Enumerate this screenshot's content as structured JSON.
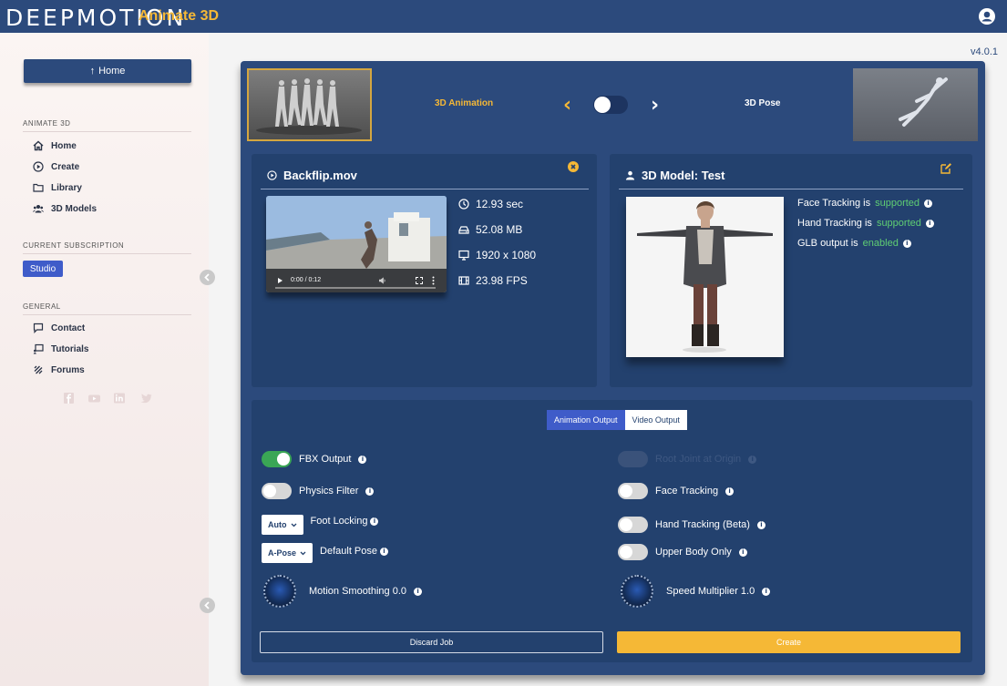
{
  "app": {
    "logo": "DEEPMOTION",
    "product": "Animate 3D",
    "version": "v4.0.1"
  },
  "sidebar": {
    "home_button": "Home",
    "section_animate": "ANIMATE 3D",
    "items": [
      {
        "label": "Home",
        "icon": "home-icon"
      },
      {
        "label": "Create",
        "icon": "play-circle-icon"
      },
      {
        "label": "Library",
        "icon": "folder-icon"
      },
      {
        "label": "3D Models",
        "icon": "users-icon"
      }
    ],
    "section_subscription": "CURRENT SUBSCRIPTION",
    "subscription": "Studio",
    "section_general": "GENERAL",
    "general_items": [
      {
        "label": "Contact",
        "icon": "chat-icon"
      },
      {
        "label": "Tutorials",
        "icon": "tutorial-icon"
      },
      {
        "label": "Forums",
        "icon": "forum-icon"
      }
    ]
  },
  "mode": {
    "left_label": "3D Animation",
    "right_label": "3D Pose"
  },
  "video_card": {
    "title": "Backflip.mov",
    "time": "0:00 / 0:12",
    "duration": "12.93 sec",
    "size": "52.08 MB",
    "resolution": "1920 x 1080",
    "fps": "23.98 FPS"
  },
  "model_card": {
    "title": "3D Model:  Test",
    "face_prefix": "Face Tracking is",
    "face_status": "supported",
    "hand_prefix": "Hand Tracking is",
    "hand_status": "supported",
    "glb_prefix": "GLB output is",
    "glb_status": "enabled"
  },
  "output_tabs": {
    "active": "Animation Output",
    "inactive": "Video Output"
  },
  "options": {
    "fbx": "FBX Output",
    "physics": "Physics Filter",
    "foot_locking_value": "Auto",
    "foot_locking": "Foot Locking",
    "default_pose_value": "A-Pose",
    "default_pose": "Default Pose",
    "motion_smoothing": "Motion Smoothing 0.0",
    "root_joint": "Root Joint at Origin",
    "face_tracking": "Face Tracking",
    "hand_tracking": "Hand Tracking (Beta)",
    "upper_body": "Upper Body Only",
    "speed_multiplier": "Speed Multiplier 1.0"
  },
  "actions": {
    "discard": "Discard Job",
    "create": "Create"
  },
  "colors": {
    "navy": "#2c4a7c",
    "card": "#23416e",
    "accent": "#f5b836",
    "green": "#5fce73",
    "blue": "#3f5cc9"
  }
}
